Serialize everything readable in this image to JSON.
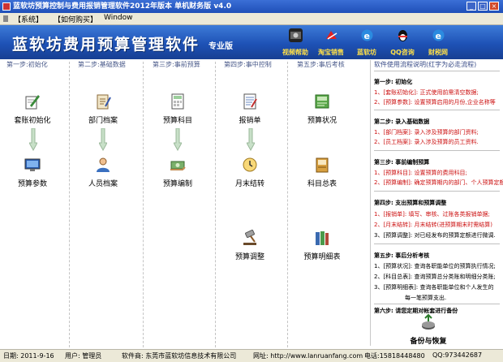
{
  "window": {
    "title": "蓝软坊预算控制与费用报销管理软件2012年版本 单机财务版 v4.0",
    "minimize_glyph": "_",
    "maximize_glyph": "□",
    "close_glyph": "×"
  },
  "menu": {
    "system": "【系统】",
    "buy": "【如何购买】",
    "window": "Window"
  },
  "banner": {
    "title": "蓝软坊费用预算管理软件",
    "edition": "专业版",
    "buttons": [
      {
        "label": "视频帮助",
        "icon": "video-help-icon"
      },
      {
        "label": "淘宝销售",
        "icon": "taobao-sales-icon"
      },
      {
        "label": "蓝软坊",
        "icon": "ie-browser-icon"
      },
      {
        "label": "QQ咨询",
        "icon": "qq-icon"
      },
      {
        "label": "财税网",
        "icon": "ie-browser-icon"
      }
    ]
  },
  "columns": {
    "step1": "第一步:初始化",
    "step2": "第二步:基础数据",
    "step3": "第三步:事前预算",
    "step4": "第四步:事中控制",
    "step5": "第五步:事后考核",
    "help": "软件使用流程说明(红字为必走流程)"
  },
  "modules": {
    "account_init": "套账初始化",
    "budget_params": "预算参数",
    "dept_file": "部门档案",
    "staff_file": "人员档案",
    "budget_items": "预算科目",
    "budget_prep": "预算编制",
    "expense_claim": "报销单",
    "month_close": "月末结转",
    "budget_adjust": "预算调整",
    "budget_status": "预算状况",
    "ledger_summary": "科目总表",
    "budget_detail": "预算明细表",
    "backup_restore": "备份与恢复"
  },
  "help": {
    "s1_title": "第一步: 初始化",
    "s1_l1": "1、[套账初始化]: 正式使用前需清空数据;",
    "s1_l2": "2、[预算参数]: 设置预算启用的月份,企业名称等",
    "s2_title": "第二步: 录入基础数据",
    "s2_l1": "1、[部门档案]: 录入涉及预算的部门资料;",
    "s2_l2": "2、[员工档案]: 录入涉及预算的员工资料.",
    "s3_title": "第三步: 事前编制预算",
    "s3_l1": "1、[预算科目]: 设置预算的费用科目;",
    "s3_l2": "2、[预算编制]: 确定预算期内的部门、个人预算定额",
    "s4_title": "第四步: 支出预算和预算调整",
    "s4_l1": "1、[报销单]: 填写、审核、过账各类报销单据;",
    "s4_l2": "2、[月末结转]: 月末结转(进预算期末时需结算)",
    "s4_l3": "3、[预算调整]: 对已经发布的预算定额进行微调.",
    "s5_title": "第五步: 事后分析考核",
    "s5_l1": "1、[预算状况]: 查询各职能单位的预算执行情况;",
    "s5_l2": "2、[科目总表]: 查询预算总分类账和明细分类账;",
    "s5_l3": "3、[预算明细表]: 查询各职能单位和个人发生的",
    "s5_l4": "每一笔预算支出.",
    "s6_title": "第六步: 请您定期对帐套进行备份"
  },
  "status": {
    "date": "日期: 2011-9-16",
    "user": "用户: 管理员",
    "company": "软件商: 东莞市蓝软坊信息技术有限公司",
    "site": "网址: http://www.lanruanfang.com",
    "phone": "电话:15818448480",
    "qq": "QQ:973442687"
  },
  "colors": {
    "banner_top": "#3d7bd8",
    "banner_bottom": "#173f92",
    "accent_yellow": "#ffe048",
    "required_red": "#cc1111"
  }
}
